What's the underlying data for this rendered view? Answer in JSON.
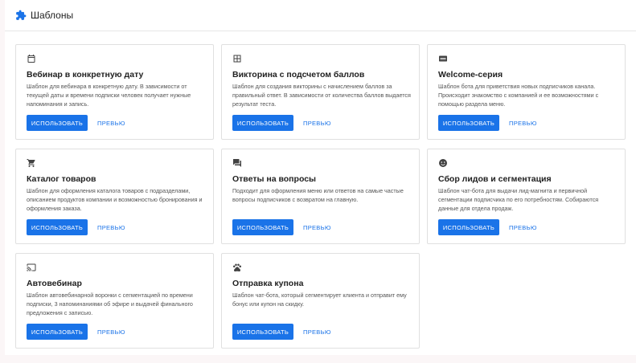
{
  "header": {
    "title": "Шаблоны",
    "icon": "puzzle-icon",
    "accent": "#1a73e8"
  },
  "buttons": {
    "use_label": "ИСПОЛЬЗОВАТЬ",
    "preview_label": "ПРЕВЬЮ"
  },
  "templates": [
    {
      "icon": "calendar-icon",
      "title": "Вебинар в конкретную дату",
      "description": "Шаблон для вебинара в конкретную дату. В зависимости от текущей даты и времени подписки человек получает нужные напоминания и запись."
    },
    {
      "icon": "grid-icon",
      "title": "Викторина с подсчетом баллов",
      "description": "Шаблон для создания викторины с начислением баллов за правильный ответ. В зависимости от количества баллов выдается результат теста."
    },
    {
      "icon": "new-badge-icon",
      "title": "Welcome-серия",
      "description": "Шаблон бота для приветствия новых подписчиков канала. Происходит знакомство с компанией и ее возможностями с помощью раздела меню."
    },
    {
      "icon": "cart-icon",
      "title": "Каталог товаров",
      "description": "Шаблон для оформления каталога товаров с подразделами, описанием продуктов компании и возможностью бронирования и оформления заказа."
    },
    {
      "icon": "chat-icon",
      "title": "Ответы на вопросы",
      "description": "Подходит для оформления меню или ответов на самые частые вопросы подписчиков с возвратом на главную."
    },
    {
      "icon": "face-icon",
      "title": "Сбор лидов и сегментация",
      "description": "Шаблон чат-бота для выдачи лид-магнита и первичной сегментации подписчика по его потребностям. Собираются данные для отдела продаж."
    },
    {
      "icon": "cast-icon",
      "title": "Автовебинар",
      "description": "Шаблон автовебинарной воронки с сегментацией по времени подписки, 3 напоминаниями об эфире и выдачей финального предложения с записью."
    },
    {
      "icon": "pets-icon",
      "title": "Отправка купона",
      "description": "Шаблон чат-бота, который сегментирует клиента и отправит ему бонус или купон на скидку."
    }
  ]
}
